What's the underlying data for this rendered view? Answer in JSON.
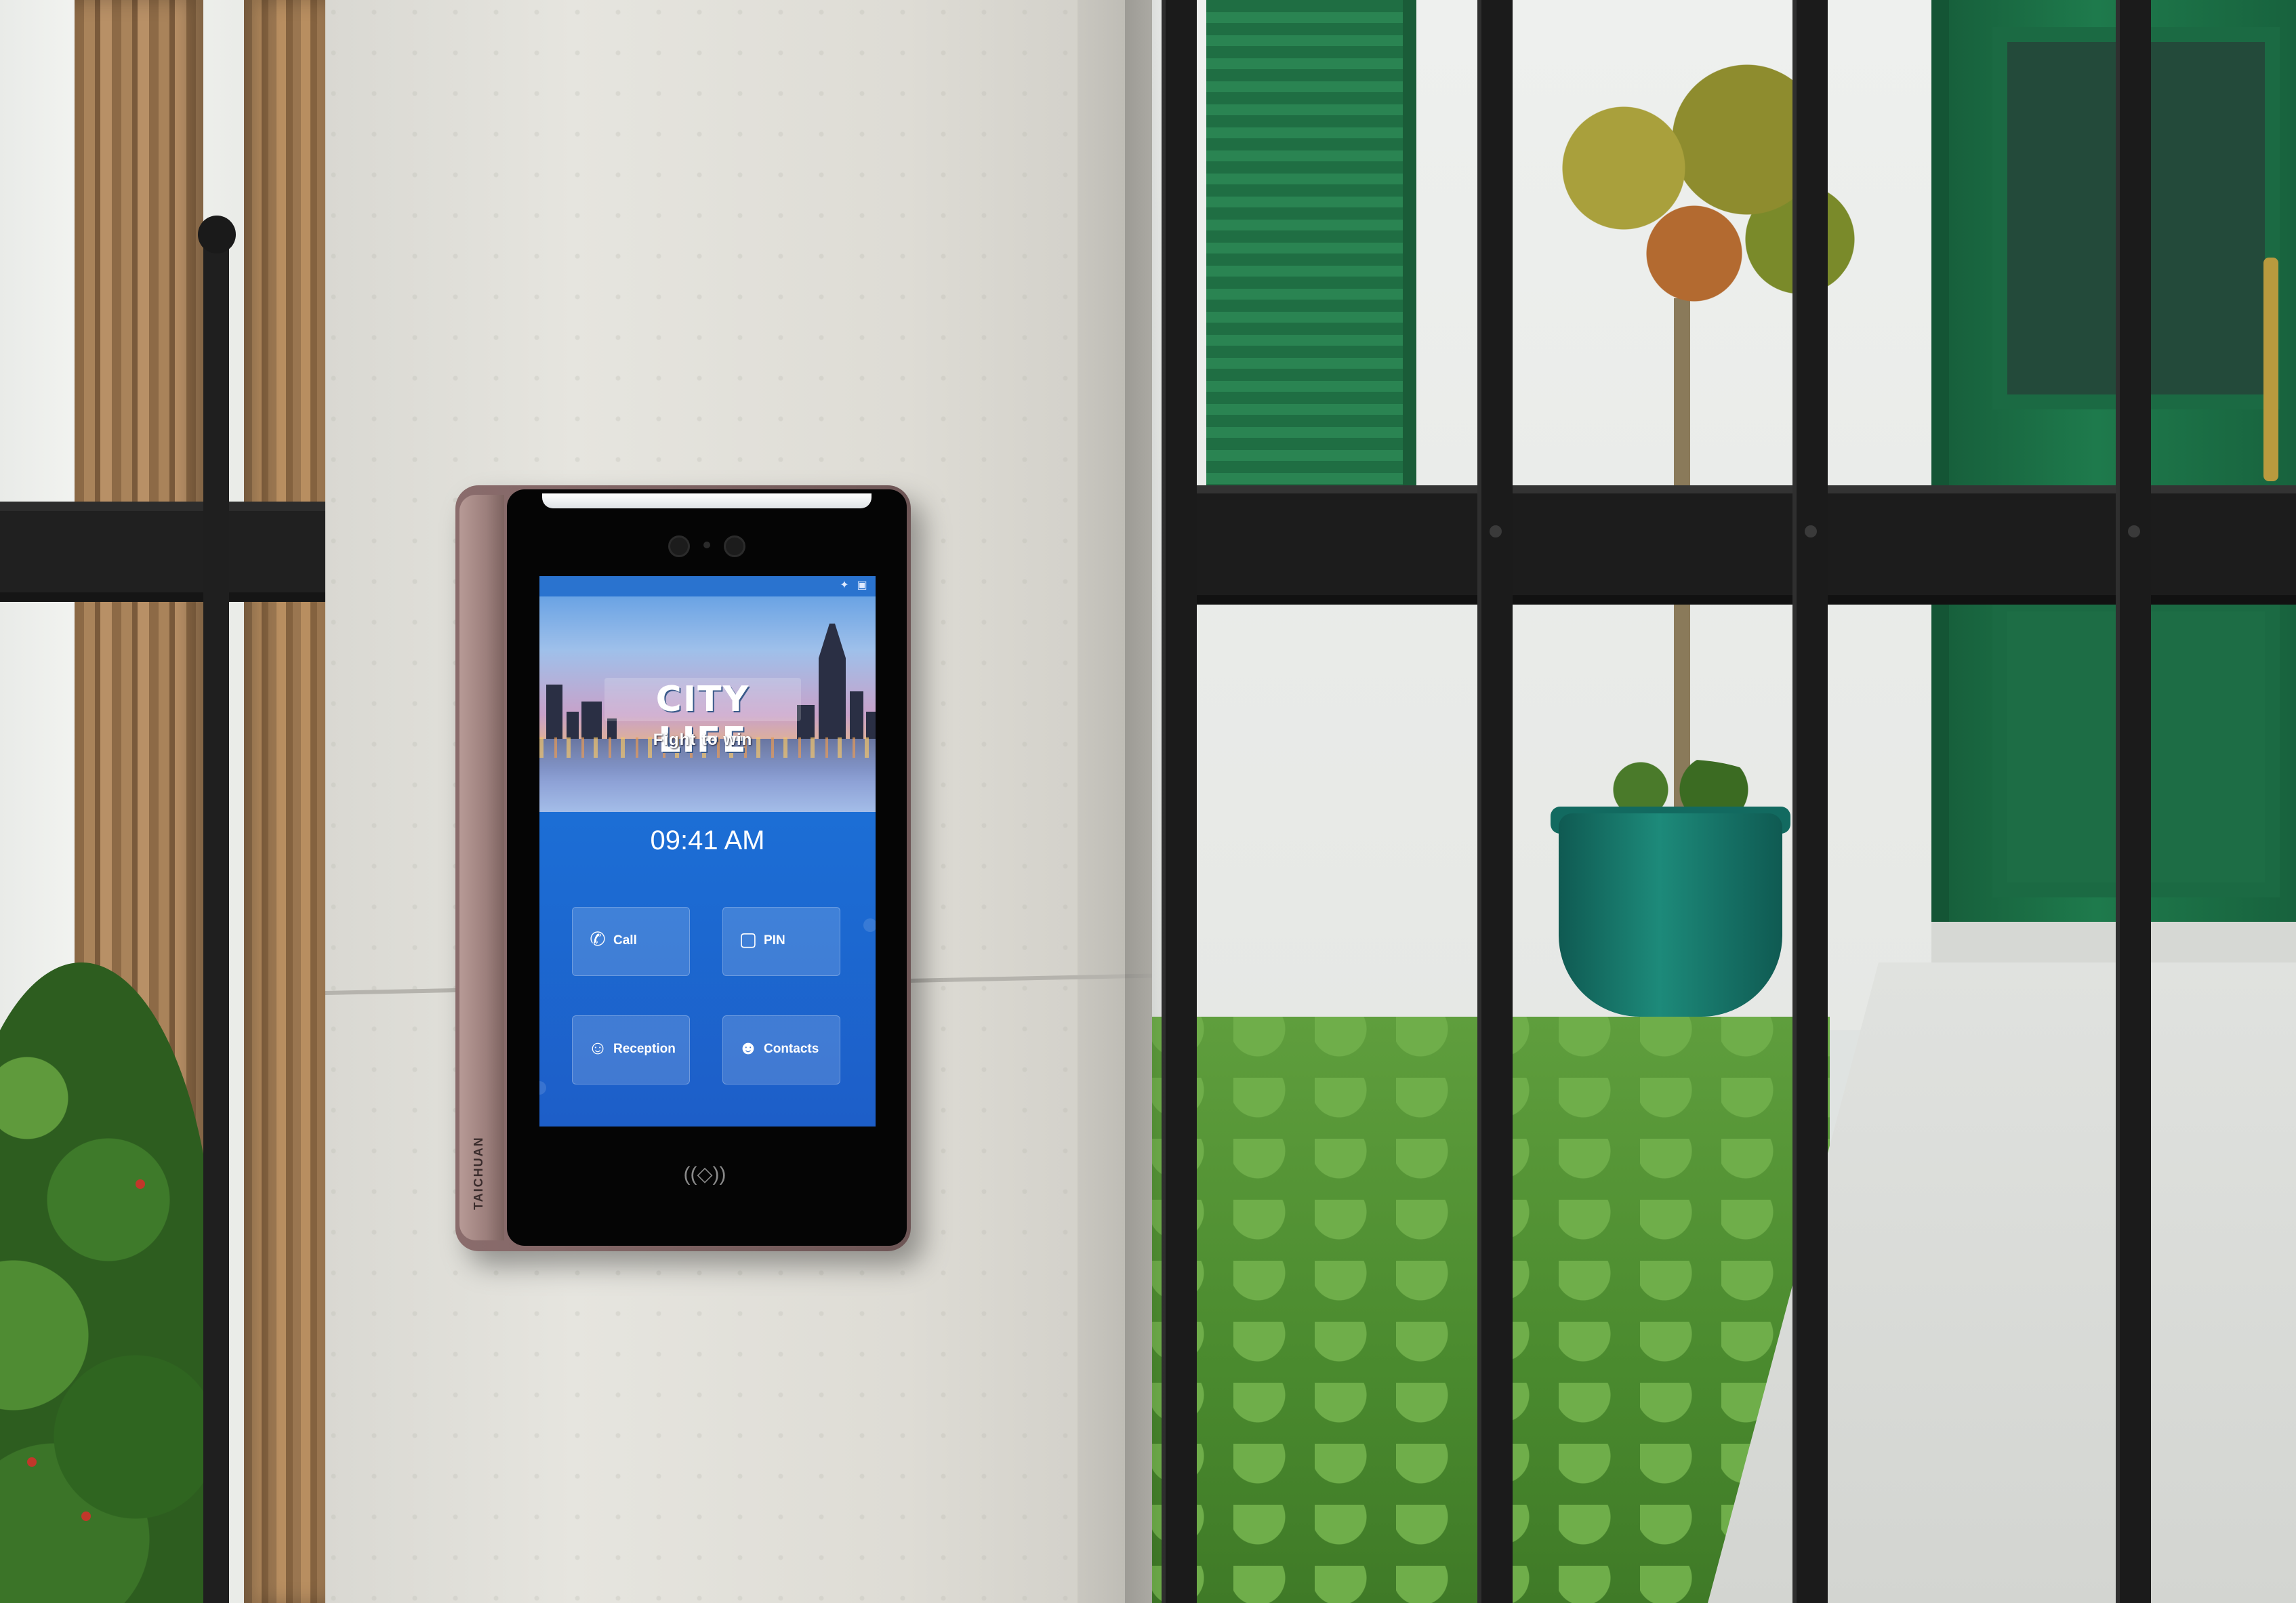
{
  "device": {
    "brand": "TAICHUAN",
    "nfc_symbol": "((◇))"
  },
  "screen": {
    "status_icons": [
      "wifi-icon",
      "screen-icon"
    ],
    "banner": {
      "title": "CITY LIFE",
      "subtitle": "Fight to win"
    },
    "clock": "09:41 AM",
    "tiles": [
      {
        "label": "Call",
        "icon": "phone-icon"
      },
      {
        "label": "PIN",
        "icon": "lock-icon"
      },
      {
        "label": "Reception",
        "icon": "reception-icon"
      },
      {
        "label": "Contacts",
        "icon": "contacts-icon"
      }
    ]
  },
  "colors": {
    "screen_blue": "#1c6fd6",
    "device_frame": "#8a6c6c",
    "gate": "#1b1b1b",
    "door_green": "#1e7a4c"
  }
}
